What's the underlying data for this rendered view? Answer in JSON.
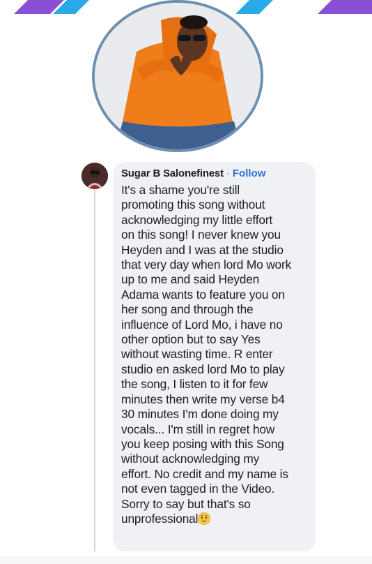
{
  "colors": {
    "stripe_purple": "#8b4fd6",
    "stripe_blue": "#29a9e8",
    "bubble_bg": "#eff1f4",
    "follow_blue": "#2e6fd6",
    "profile_ring": "#6f8fb0"
  },
  "icons": {
    "profile_photo": "person-orange-hoodie-photo",
    "commenter_avatar": "commenter-avatar-photo",
    "emoji": "worried-face-emoji"
  },
  "comment": {
    "author": "Sugar B Salonefinest",
    "separator": "·",
    "follow_label": "Follow",
    "lines": [
      "It's a shame you're still",
      "promoting this song without",
      "acknowledging my little effort",
      "on this song! I never knew you",
      "Heyden and I was at the studio",
      "that very day when lord Mo work",
      "up to me and said Heyden",
      "Adama wants to feature you on",
      "her song and through the",
      "influence of Lord Mo, i have no",
      "other option but to say Yes",
      "without wasting time. R enter",
      "studio en asked lord Mo to play",
      "the song, I listen to it for few",
      "minutes then write my verse b4",
      "30 minutes I'm done doing my",
      "vocals... I'm still in regret how",
      "you keep posing with this Song",
      "without acknowledging my",
      "effort. No credit and my name is",
      "not even tagged in the Video.",
      "Sorry to say but that's so",
      "unprofessional"
    ]
  }
}
